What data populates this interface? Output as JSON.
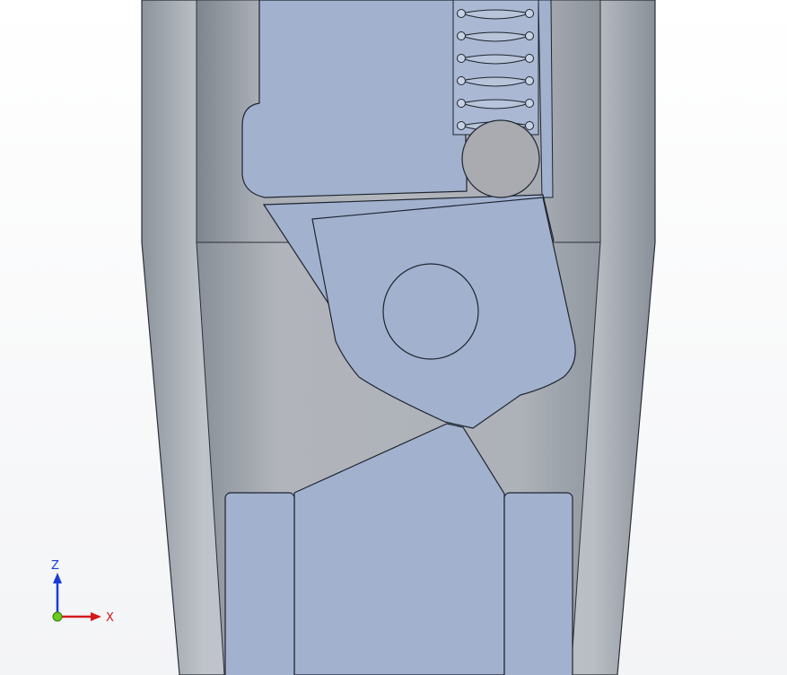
{
  "viewport": {
    "view": "section view",
    "colors": {
      "background": "#ffffff",
      "housing": "#a7adb5",
      "housing_dark": "#7c838c",
      "part": "#a2b1ce",
      "part_edge": "#1e2530",
      "spring": "#b8c4da"
    }
  },
  "triad": {
    "z_label": "Z",
    "x_label": "X",
    "colors": {
      "z": "#1a3cd6",
      "x": "#d41a1a",
      "origin": "#6acc1a"
    }
  }
}
